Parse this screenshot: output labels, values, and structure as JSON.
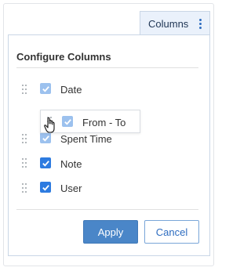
{
  "toolbar": {
    "columns_label": "Columns"
  },
  "panel": {
    "title": "Configure Columns",
    "columns": [
      {
        "label": "Date",
        "checked": true
      },
      {
        "label": "Spent Time",
        "checked": true
      },
      {
        "label": "Note",
        "checked": true
      },
      {
        "label": "User",
        "checked": true
      }
    ],
    "dragging": {
      "label": "From - To",
      "checked": true
    }
  },
  "actions": {
    "apply_label": "Apply",
    "cancel_label": "Cancel"
  },
  "colors": {
    "accent": "#2d7be0",
    "apply_bg": "#4a86c8",
    "header_bg": "#eaf1fb"
  },
  "icons": [
    "kebab-menu-icon",
    "drag-handle-icon",
    "checkbox-checked-icon",
    "grab-hand-cursor-icon"
  ]
}
